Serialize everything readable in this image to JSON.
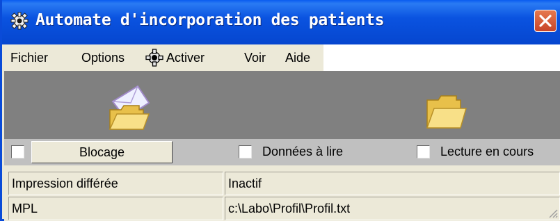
{
  "window": {
    "title": "Automate d'incorporation des patients"
  },
  "menu": {
    "items": [
      "Fichier",
      "Options",
      "Activer",
      "Voir",
      "Aide"
    ]
  },
  "status": {
    "button_label": "Blocage",
    "checkbox_1": "Données à lire",
    "checkbox_2": "Lecture en cours"
  },
  "grid": {
    "rows": [
      {
        "label": "Impression différée",
        "value": "Inactif"
      },
      {
        "label": "MPL",
        "value": "c:\\Labo\\Profil\\Profil.txt"
      }
    ]
  },
  "icons": {
    "title": "gear-icon",
    "menu": "gear-icon",
    "toolbar_1": "folder-envelope-icon",
    "toolbar_2": "open-folder-icon",
    "close": "close-icon"
  },
  "colors": {
    "titlebar": "#0a53e0",
    "toolbar": "#808080",
    "statusbar": "#c0c0c0",
    "close": "#d35a38"
  }
}
